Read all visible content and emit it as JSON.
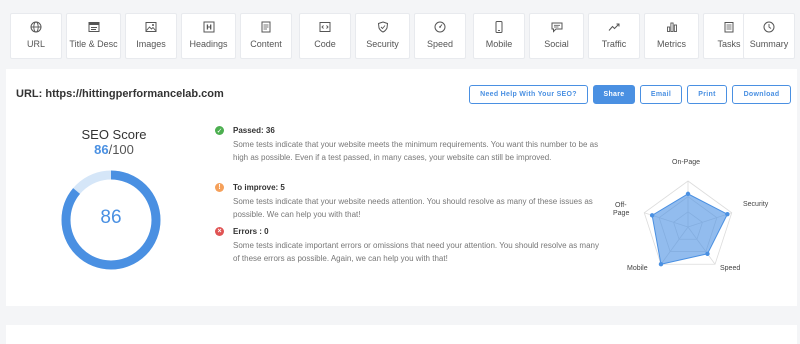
{
  "nav": [
    {
      "label": "URL",
      "icon": "globe-icon"
    },
    {
      "label": "Title & Desc",
      "icon": "window-icon"
    },
    {
      "label": "Images",
      "icon": "image-icon"
    },
    {
      "label": "Headings",
      "icon": "heading-icon"
    },
    {
      "label": "Content",
      "icon": "document-icon"
    },
    {
      "label": "Code",
      "icon": "code-icon"
    },
    {
      "label": "Security",
      "icon": "shield-icon"
    },
    {
      "label": "Speed",
      "icon": "speedometer-icon"
    },
    {
      "label": "Mobile",
      "icon": "mobile-icon"
    },
    {
      "label": "Social",
      "icon": "chat-icon"
    },
    {
      "label": "Traffic",
      "icon": "trend-icon"
    },
    {
      "label": "Metrics",
      "icon": "bar-chart-icon"
    },
    {
      "label": "Tasks",
      "icon": "clipboard-icon"
    },
    {
      "label": "Summary",
      "icon": "clock-icon"
    }
  ],
  "header": {
    "url_prefix": "URL:",
    "url": "https://hittingperformancelab.com"
  },
  "buttons": {
    "help": "Need Help With Your SEO?",
    "share": "Share",
    "email": "Email",
    "print": "Print",
    "download": "Download"
  },
  "score": {
    "title": "SEO Score",
    "value": "86",
    "max": "/100",
    "center": "86",
    "fraction": 0.86
  },
  "results": {
    "passed": {
      "label": "Passed: 36",
      "desc": "Some tests indicate that your website meets the minimum requirements. You want this number to be as high as possible. Even if a test passed, in many cases, your website can still be improved."
    },
    "improve": {
      "label": "To improve: 5",
      "desc": "Some tests indicate that your website needs attention. You should resolve as many of these issues as possible. We can help you with that!"
    },
    "errors": {
      "label": "Errors : 0",
      "desc": "Some tests indicate important errors or omissions that need your attention. You should resolve as many of these errors as possible. Again, we can help you with that!"
    }
  },
  "radar": {
    "axes": [
      "On-Page",
      "Security",
      "Speed",
      "Mobile",
      "Off-Page"
    ],
    "off_page_line1": "Off-",
    "off_page_line2": "Page",
    "values": [
      0.72,
      0.9,
      0.72,
      1.0,
      0.82
    ]
  },
  "colors": {
    "accent": "#4a90e2",
    "pass": "#4caf50",
    "warn": "#f5a05a",
    "error": "#e05454"
  }
}
